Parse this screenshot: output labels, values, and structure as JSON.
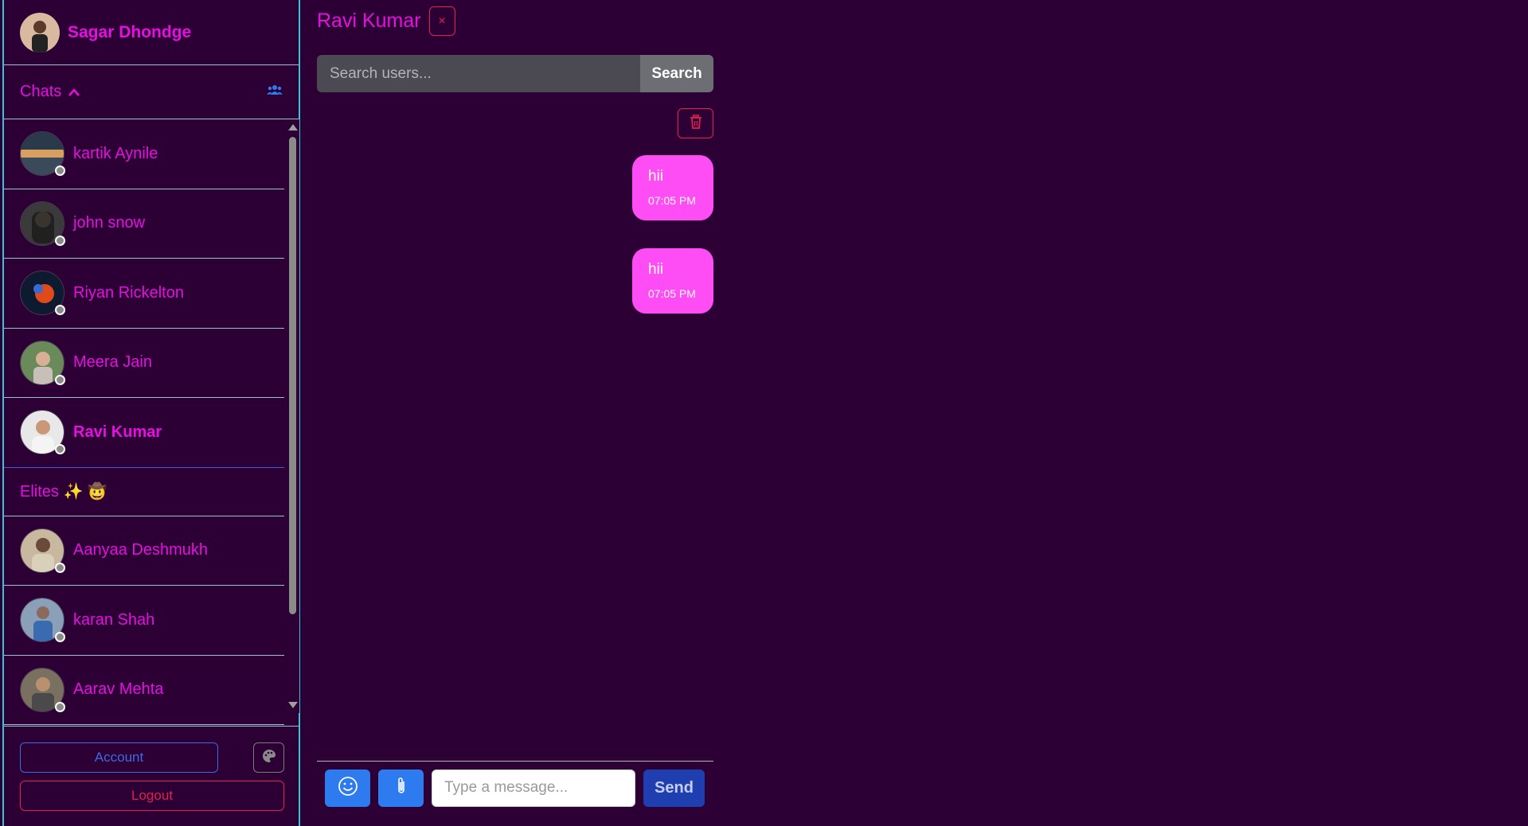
{
  "current_user": {
    "name": "Sagar Dhondge"
  },
  "chats_section": {
    "title": "Chats",
    "toggle_icon": "chevron-up-icon",
    "group_icon": "users-icon"
  },
  "contacts": [
    {
      "name": "kartik Aynile",
      "status": "offline"
    },
    {
      "name": "john snow",
      "status": "offline"
    },
    {
      "name": "Riyan Rickelton",
      "status": "offline"
    },
    {
      "name": "Meera Jain",
      "status": "offline"
    },
    {
      "name": "Ravi Kumar",
      "status": "offline",
      "active": true
    }
  ],
  "groups": [
    {
      "name": "Elites ✨ 🤠"
    }
  ],
  "contacts_more": [
    {
      "name": "Aanyaa Deshmukh",
      "status": "offline"
    },
    {
      "name": "karan Shah",
      "status": "offline"
    },
    {
      "name": "Aarav Mehta",
      "status": "offline"
    }
  ],
  "footer": {
    "account_label": "Account",
    "logout_label": "Logout",
    "theme_icon": "palette-icon"
  },
  "chat": {
    "title": "Ravi Kumar",
    "close_label": "×",
    "search": {
      "placeholder": "Search users...",
      "button_label": "Search"
    },
    "messages": [
      {
        "text": "hii",
        "time": "07:05 PM"
      },
      {
        "text": "hii",
        "time": "07:05 PM"
      }
    ],
    "composer": {
      "placeholder": "Type a message...",
      "send_label": "Send"
    }
  },
  "colors": {
    "background": "#2d0035",
    "accent": "#e40fe0",
    "bubble": "#ff4df5",
    "primary": "#2e7bf0",
    "danger": "#e02050"
  }
}
